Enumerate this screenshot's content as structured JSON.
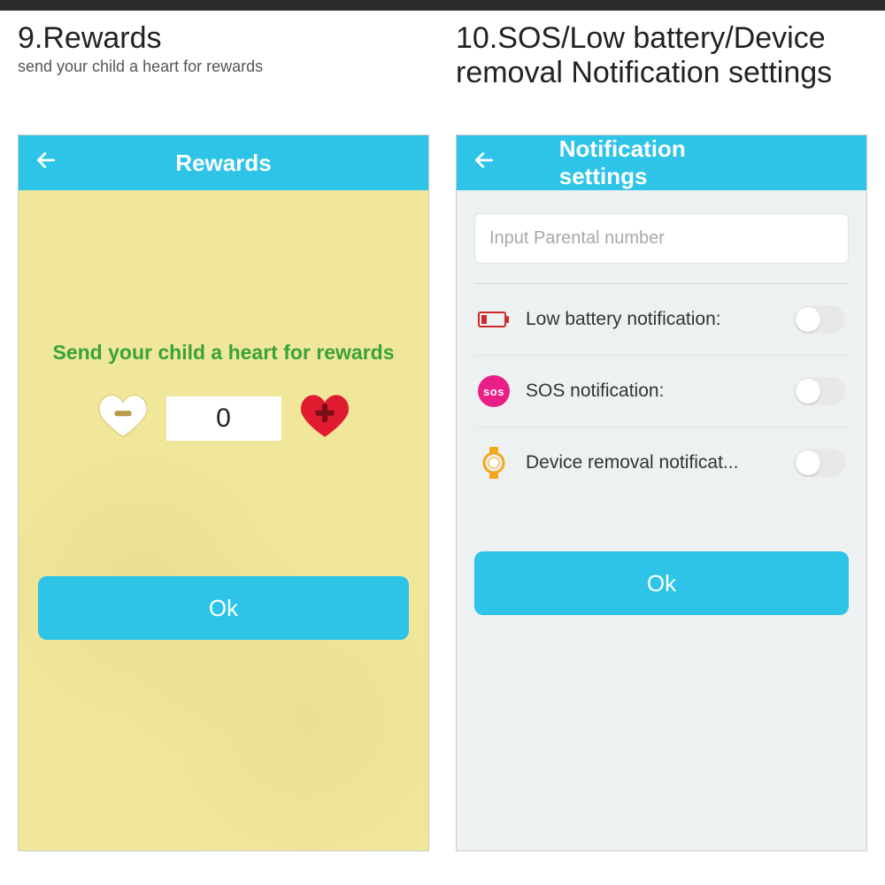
{
  "left": {
    "section_title": "9.Rewards",
    "section_subtitle": "send your child a heart for rewards",
    "app_title": "Rewards",
    "prompt": "Send your child a heart for rewards",
    "count": "0",
    "ok": "Ok"
  },
  "right": {
    "section_title": "10.SOS/Low battery/Device removal Notification settings",
    "app_title": "Notification settings",
    "input_placeholder": "Input Parental number",
    "rows": {
      "low_battery": "Low battery notification:",
      "sos": "SOS notification:",
      "device_removal": "Device removal notificat..."
    },
    "ok": "Ok",
    "sos_icon_text": "sos"
  },
  "toggles": {
    "low_battery": false,
    "sos": false,
    "device_removal": false
  }
}
